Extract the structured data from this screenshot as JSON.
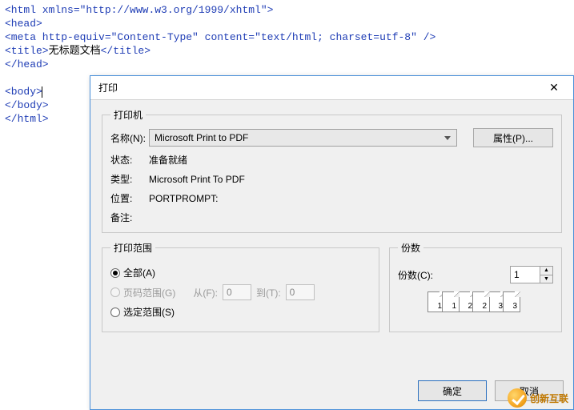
{
  "code": {
    "line1_open": "<html xmlns=",
    "line1_attr": "\"http://www.w3.org/1999/xhtml\"",
    "line1_close": ">",
    "line2": "<head>",
    "line3a": "<meta http-equiv=",
    "line3b": "\"Content-Type\"",
    "line3c": " content=",
    "line3d": "\"text/html; charset=utf-8\"",
    "line3e": " />",
    "line4a": "<title>",
    "line4b": "无标题文档",
    "line4c": "</title>",
    "line5": "</head>",
    "line6": "",
    "line7": "<body>",
    "line8": "</body>",
    "line9": "</html>"
  },
  "dialog": {
    "title": "打印",
    "printer": {
      "group_label": "打印机",
      "name_label": "名称(N):",
      "name_value": "Microsoft Print to PDF",
      "properties_label": "属性(P)...",
      "status_label": "状态:",
      "status_value": "准备就绪",
      "type_label": "类型:",
      "type_value": "Microsoft Print To PDF",
      "location_label": "位置:",
      "location_value": "PORTPROMPT:",
      "comment_label": "备注:",
      "comment_value": ""
    },
    "range": {
      "group_label": "打印范围",
      "all_label": "全部(A)",
      "pages_label": "页码范围(G)",
      "from_label": "从(F):",
      "from_value": "0",
      "to_label": "到(T):",
      "to_value": "0",
      "selection_label": "选定范围(S)"
    },
    "copies": {
      "group_label": "份数",
      "count_label": "份数(C):",
      "count_value": "1",
      "page_nums": [
        "1",
        "1",
        "2",
        "2",
        "3",
        "3"
      ]
    },
    "buttons": {
      "ok": "确定",
      "cancel": "取消"
    },
    "watermark": "创新互联"
  }
}
